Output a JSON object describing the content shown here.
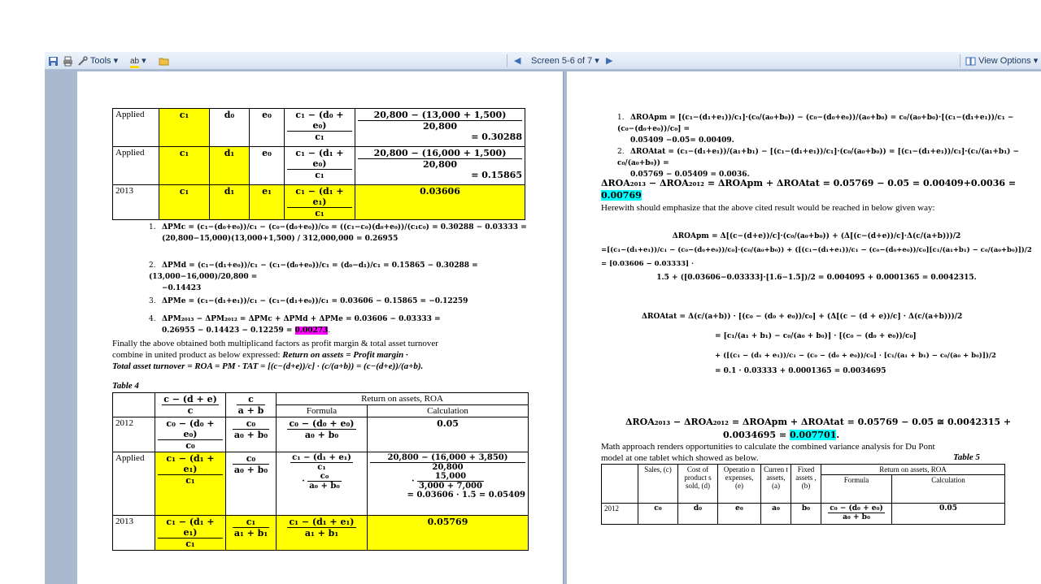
{
  "toolbar": {
    "tools_label": "Tools",
    "screen_label": "Screen 5-6 of 7",
    "view_options_label": "View Options"
  },
  "page1": {
    "top_table": {
      "row1": {
        "label": "Applied",
        "c": "c₁",
        "d": "d₀",
        "e": "e₀",
        "formula_num": "c₁ − (d₀ + e₀)",
        "formula_den": "c₁",
        "calc_num": "20,800 − (13,000 + 1,500)",
        "calc_den": "20,800",
        "calc_res": "= 0.30288"
      },
      "row2": {
        "label": "Applied",
        "c": "c₁",
        "d": "d₁",
        "e": "e₀",
        "formula_num": "c₁ − (d₁ + e₀)",
        "formula_den": "c₁",
        "calc_num": "20,800 − (16,000 + 1,500)",
        "calc_den": "20,800",
        "calc_res": "= 0.15865"
      },
      "row3": {
        "label": "2013",
        "c": "c₁",
        "d": "d₁",
        "e": "e₁",
        "formula_num": "c₁ − (d₁ + e₁)",
        "formula_den": "c₁",
        "calc": "0.03606"
      }
    },
    "items": [
      {
        "n": "1.",
        "line1": "ΔPMc = (c₁−(d₀+e₀))/c₁ − (c₀−(d₀+e₀))/c₀ = ((c₁−c₀)(d₀+e₀))/(c₁c₀) = 0.30288 − 0.03333 =",
        "line2": "(20,800−15,000)(13,000+1,500) / 312,000,000 = 0.26955"
      },
      {
        "n": "2.",
        "line1": "ΔPMd = (c₁−(d₁+e₀))/c₁ − (c₁−(d₀+e₀))/c₁ = (d₀−d₁)/c₁ = 0.15865 − 0.30288 = (13,000−16,000)/20,800 =",
        "line2": "−0.14423"
      },
      {
        "n": "3.",
        "line1": "ΔPMe = (c₁−(d₁+e₁))/c₁ − (c₁−(d₁+e₀))/c₁ = 0.03606 − 0.15865 = −0.12259",
        "line2": ""
      },
      {
        "n": "4.",
        "line1": "ΔPM₂₀₁₃ − ΔPM₂₀₁₂ = ΔPMc + ΔPMd + ΔPMe = 0.03606 − 0.03333 =",
        "line2": "0.26955 − 0.14423 − 0.12259 = ",
        "highlight": "0.00273",
        "line2_end": "."
      }
    ],
    "para1": "Finally the above obtained both multiplicand factors as profit margin & total asset turnover",
    "para2_a": "combine in united product as below expressed: ",
    "para2_b": "Return on assets = Profit margin ·",
    "para3": "Total asset turnover = ROA = PM · TAT = [(c−(d+e))/c] · (c/(a+b)) = (c−(d+e))/(a+b).",
    "table4_title": "Table 4",
    "table4": {
      "h_col1_num": "c − (d + e)",
      "h_col1_den": "c",
      "h_col2_num": "c",
      "h_col2_den": "a + b",
      "h_roa": "Return on assets, ROA",
      "h_formula": "Formula",
      "h_calc": "Calculation",
      "r2012": {
        "label": "2012",
        "c1n": "c₀ − (d₀ + e₀)",
        "c1d": "c₀",
        "c2n": "c₀",
        "c2d": "a₀ + b₀",
        "fn": "c₀ − (d₀ + e₀)",
        "fd": "a₀ + b₀",
        "calc": "0.05"
      },
      "rApplied": {
        "label": "Applied",
        "c1n": "c₁ − (d₁ + e₁)",
        "c1d": "c₁",
        "c2n": "c₀",
        "c2d": "a₀ + b₀",
        "f1n": "c₁ − (d₁ + e₁)",
        "f1d": "c₁",
        "f2n": "c₀",
        "f2d": "a₀ + b₀",
        "calc1n": "20,800 − (16,000 + 3,850)",
        "calc1d": "20,800",
        "calc2n": "15,000",
        "calc2d": "3,000 + 7,000",
        "calc_res": "= 0.03606 · 1.5 = 0.05409"
      },
      "r2013": {
        "label": "2013",
        "c1n": "c₁ − (d₁ + e₁)",
        "c1d": "c₁",
        "c2n": "c₁",
        "c2d": "a₁ + b₁",
        "fn": "c₁ − (d₁ + e₁)",
        "fd": "a₁ + b₁",
        "calc": "0.05769"
      }
    }
  },
  "page2": {
    "item1_a": "ΔROApm = [(c₁−(d₁+e₁))/c₁]·(c₀/(a₀+b₀)) − (c₀−(d₀+e₀))/(a₀+b₀) = c₀/(a₀+b₀)·[(c₁−(d₁+e₁))/c₁ − (c₀−(d₀+e₀))/c₀] =",
    "item1_b": "0.05409 −0.05= 0.00409.",
    "item2_a": "ΔROAtat = (c₁−(d₁+e₁))/(a₁+b₁) − [(c₁−(d₁+e₁))/c₁]·(c₀/(a₀+b₀)) = [(c₁−(d₁+e₁))/c₁]·(c₁/(a₁+b₁) − c₀/(a₀+b₀)) =",
    "item2_b": "0.05769 − 0.05409 = 0.0036.",
    "sum_a": "ΔROA₂₀₁₃ − ΔROA₂₀₁₂ = ΔROApm + ΔROAtat = 0.05769 − 0.05 = 0.00409+0.0036 =",
    "sum_hl": "0.00769",
    "herewith": "Herewith should emphasize that the above cited result would be reached in below given way:",
    "eq_pm1": "ΔROApm = Δ[(c−(d+e))/c]·(c₀/(a₀+b₀)) + (Δ[(c−(d+e))/c]·Δ(c/(a+b)))/2",
    "eq_pm2": "=[(c₁−(d₁+e₁))/c₁ − (c₀−(d₀+e₀))/c₀]·(c₀/(a₀+b₀)) + ([(c₁−(d₁+e₁))/c₁ − (c₀−(d₀+e₀))/c₀][c₁/(a₁+b₁) − c₀/(a₀+b₀)])/2 = [0.03606 − 0.03333] ·",
    "eq_pm3": "1.5 + ([0.03606−0.03333]·[1.6−1.5])/2 = 0.004095 + 0.0001365 = 0.0042315.",
    "eq_tat1": "ΔROAtat = Δ(c/(a+b)) · [(c₀ − (d₀ + e₀))/c₀] + (Δ[(c − (d + e))/c] · Δ(c/(a+b)))/2",
    "eq_tat2": "= [c₁/(a₁ + b₁) − c₀/(a₀ + b₀)] · [(c₀ − (d₀ + e₀))/c₀]",
    "eq_tat3": "+ ([(c₁ − (d₁ + e₁))/c₁ − (c₀ − (d₀ + e₀))/c₀] · [c₁/(a₁ + b₁) − c₀/(a₀ + b₀)])/2",
    "eq_tat4": "= 0.1 · 0.03333 + 0.0001365 = 0.0034695",
    "eq_sum2_a": "ΔROA₂₀₁₃ − ΔROA₂₀₁₂ = ΔROApm + ΔROAtat = 0.05769 − 0.05 ≅ 0.0042315 +",
    "eq_sum2_b": "0.0034695 = ",
    "eq_sum2_hl": "0.007701",
    "eq_sum2_end": ".",
    "math1": "Math approach renders opportunities to calculate the combined variance analysis for Du Pont",
    "math2": "model at one tablet which showed as below.",
    "table5_title": "Table 5",
    "table5": {
      "h_sales": "Sales, (c)",
      "h_cost": "Cost of product s sold, (d)",
      "h_opex": "Operatio n expenses, (e)",
      "h_curr": "Curren t assets, (a)",
      "h_fixed": "Fixed assets , (b)",
      "h_roa": "Return on assets, ROA",
      "h_formula": "Formula",
      "h_calc": "Calculation",
      "r2012": {
        "label": "2012",
        "c": "c₀",
        "d": "d₀",
        "e": "e₀",
        "a": "a₀",
        "b": "b₀",
        "fn": "c₀ − (d₀ + e₀)",
        "fd": "a₀ + b₀",
        "calc": "0.05"
      }
    }
  }
}
